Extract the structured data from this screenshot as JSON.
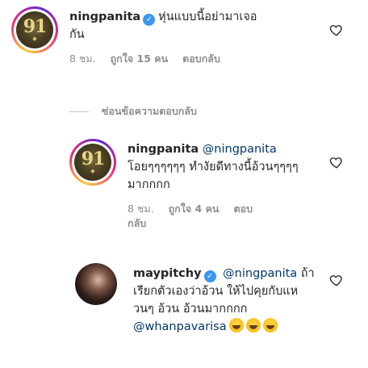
{
  "comments": [
    {
      "username": "ningpanita",
      "verified": true,
      "text": "หุ่นแบบนี้อย่ามาเจอกัน",
      "time": "8 ชม.",
      "likes": "ถูกใจ 15 คน",
      "reply": "ตอบกลับ",
      "avatar_num": "91"
    }
  ],
  "hide_replies_label": "ซ่อนข้อความตอบกลับ",
  "replies": [
    {
      "username": "ningpanita",
      "mention": "@ningpanita",
      "text": "โอยๆๆๆๆๆๆ ทำงัยดีทางนี้อ้วนๆๆๆๆ มากกกก",
      "time": "8 ชม.",
      "likes": "ถูกใจ 4 คน",
      "reply": "ตอบกลับ",
      "avatar_num": "91"
    },
    {
      "username": "maypitchy",
      "verified": true,
      "mention": "@ningpanita",
      "text": "ถ้าเรียกตัวเองว่าอ้วน ให้ไปคุยกับแหวนๆ อ้วน อ้วนมากกกก",
      "mention2": "@whanpavarisa"
    }
  ],
  "icons": {
    "heart": "heart-outline-icon",
    "verified": "verified-badge-icon",
    "emoji": "grinning-sweat-emoji-icon"
  }
}
